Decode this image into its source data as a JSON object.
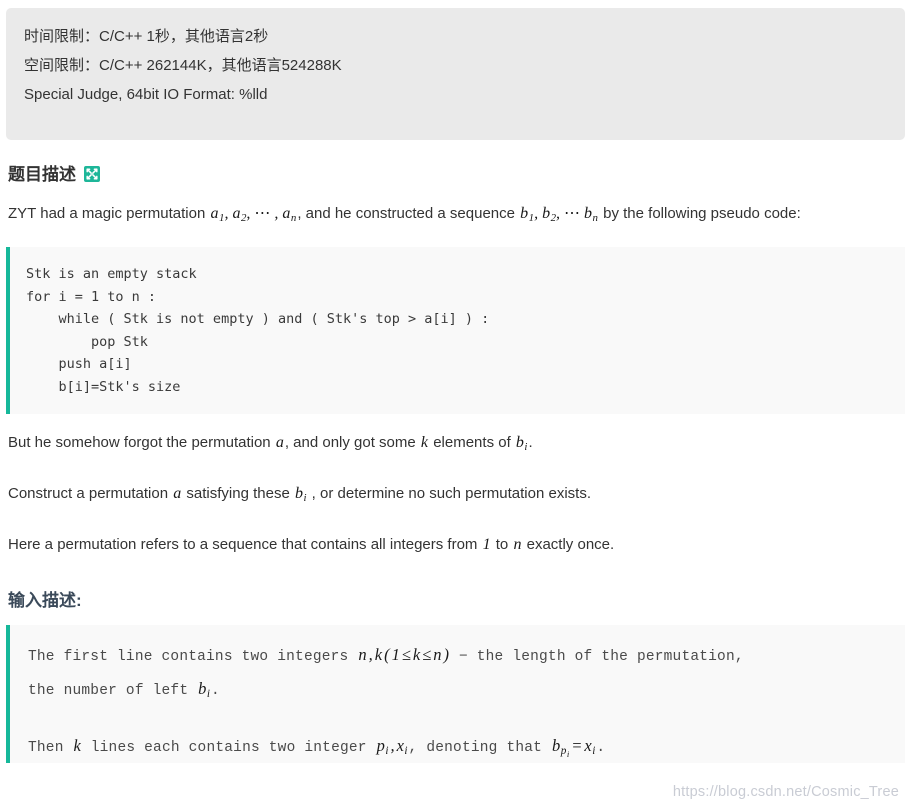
{
  "limits": {
    "time_limit": "时间限制：C/C++ 1秒，其他语言2秒",
    "space_limit": "空间限制：C/C++ 262144K，其他语言524288K",
    "judge_info": "Special Judge, 64bit IO Format: %lld"
  },
  "problem_section": {
    "heading": "题目描述",
    "expand_icon": "expand-arrows-icon",
    "intro_part1": "ZYT had a magic permutation ",
    "intro_math_a": "a",
    "intro_math_a_seq": "a₁, a₂, ⋯ , aₙ",
    "intro_part2": ", and he constructed a sequence ",
    "intro_math_b_seq": "b₁, b₂, ⋯ bₙ",
    "intro_part3": " by the following pseudo code:",
    "pseudocode": "Stk is an empty stack\nfor i = 1 to n :\n    while ( Stk is not empty ) and ( Stk's top > a[i] ) :\n        pop Stk\n    push a[i]\n    b[i]=Stk's size",
    "para2_part1": "But he somehow forgot the permutation ",
    "para2_math_a": "a",
    "para2_part2": ", and only got some ",
    "para2_math_k": "k",
    "para2_part3": " elements of ",
    "para2_math_bi": "b",
    "para2_math_bi_sub": "i",
    "para2_part4": ".",
    "para3_part1": "Construct a permutation ",
    "para3_math_a": "a",
    "para3_part2": " satisfying these ",
    "para3_math_bi": "b",
    "para3_math_bi_sub": "i",
    "para3_part3": " , or determine no such permutation exists.",
    "para4_part1": "Here a permutation refers to a sequence that contains all integers from ",
    "para4_math_one": "1",
    "para4_part2": " to ",
    "para4_math_n": "n",
    "para4_part3": " exactly once."
  },
  "input_section": {
    "heading": "输入描述:",
    "line1_a": "The first line contains two integers ",
    "line1_math_n": "n",
    "line1_comma": ",",
    "line1_math_k": "k",
    "line1_paren_open": "(",
    "line1_math_one": "1",
    "line1_le1": "≤",
    "line1_math_k2": "k",
    "line1_le2": "≤",
    "line1_math_n2": "n",
    "line1_paren_close": ")",
    "line1_b": " − the length of the permutation,",
    "line2_a": "the number of  left ",
    "line2_math_b": "b",
    "line2_math_b_sub": "i",
    "line2_b": ".",
    "line3_a": "Then ",
    "line3_math_k": "k",
    "line3_b": " lines each contains two integer ",
    "line3_math_p": "p",
    "line3_math_p_sub": "i",
    "line3_comma": ",",
    "line3_math_x": "x",
    "line3_math_x_sub": "i",
    "line3_c": ", denoting that ",
    "line3_math_bp": "b",
    "line3_math_bp_sub": "p",
    "line3_math_bp_subsub": "i",
    "line3_eq": "=",
    "line3_math_x2": "x",
    "line3_math_x2_sub": "i",
    "line3_d": "."
  },
  "watermark": {
    "text": "https://blog.csdn.net/Cosmic_Tree"
  },
  "colors": {
    "accent_green": "#16b89a",
    "header_bg": "#eaeaea",
    "code_bg": "#f9f9f9",
    "heading_blue": "#3b4a5a"
  }
}
